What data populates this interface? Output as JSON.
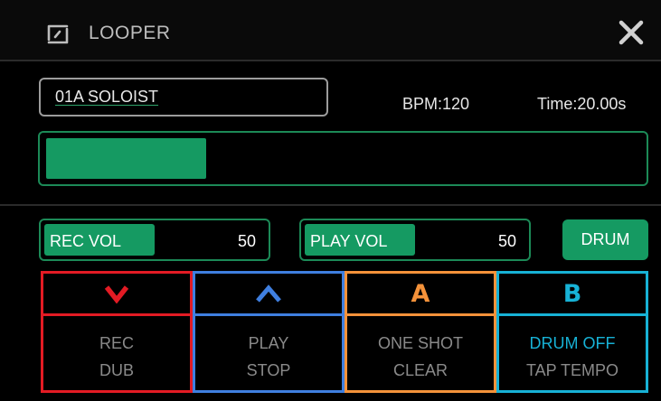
{
  "header": {
    "title": "LOOPER",
    "icon": "loop-icon"
  },
  "preset": {
    "name": "01A SOLOIST"
  },
  "bpm": "BPM:120",
  "time": "Time:20.00s",
  "progress": {
    "value": 0.27
  },
  "rec_vol": {
    "label": "REC VOL",
    "value": "50",
    "level": 0.5
  },
  "play_vol": {
    "label": "PLAY VOL",
    "value": "50",
    "level": 0.5
  },
  "drum_button": "DRUM",
  "footswitches": [
    {
      "label1": "REC",
      "label2": "DUB",
      "symbol": "chevron-down-icon",
      "color": "#e31b24"
    },
    {
      "label1": "PLAY",
      "label2": "STOP",
      "symbol": "chevron-up-icon",
      "color": "#3f7fe0"
    },
    {
      "label1": "ONE SHOT",
      "label2": "CLEAR",
      "symbol": "A",
      "color": "#f4923a"
    },
    {
      "label1": "DRUM OFF",
      "label2": "TAP TEMPO",
      "symbol": "B",
      "color": "#17b2d6"
    }
  ],
  "colors": {
    "accent": "#159a62",
    "rec": "#e31b24",
    "play": "#3f7fe0",
    "one_shot": "#f4923a",
    "drum": "#17b2d6"
  }
}
